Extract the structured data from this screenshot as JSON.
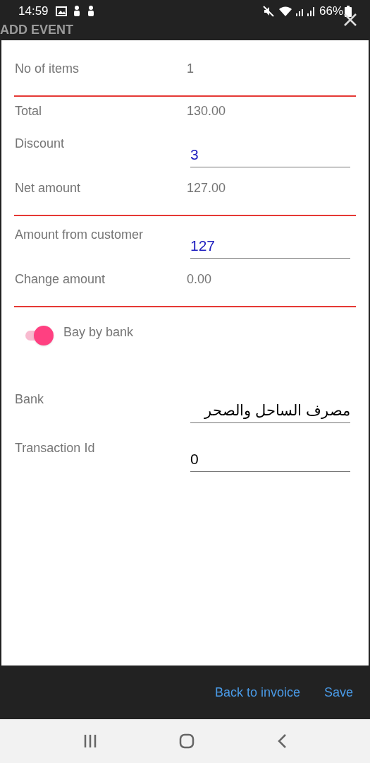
{
  "status_bar": {
    "time": "14:59",
    "battery": "66%"
  },
  "dialog": {
    "title": "ADD EVENT"
  },
  "rows": [
    {
      "kind": "text",
      "label": "No of items",
      "value": "1"
    },
    {
      "kind": "divider"
    },
    {
      "kind": "text",
      "label": "Total",
      "value": "130.00"
    },
    {
      "kind": "field",
      "label": "Discount",
      "value": "3",
      "highlighted": true
    },
    {
      "kind": "text",
      "label": "Net amount",
      "value": "127.00"
    },
    {
      "kind": "divider"
    },
    {
      "kind": "field",
      "label": "Amount from customer",
      "value": "127",
      "highlighted": true
    },
    {
      "kind": "text",
      "label": "Change amount",
      "value": "0.00"
    },
    {
      "kind": "divider"
    },
    {
      "kind": "toggle",
      "label": "Bay by bank",
      "on": true
    },
    {
      "kind": "field",
      "label": "Bank",
      "value": "مصرف الساحل والصحر",
      "highlighted": false
    },
    {
      "kind": "field",
      "label": "Transaction Id",
      "value": "0",
      "highlighted": false
    }
  ],
  "buttons": [
    "Back to invoice",
    "Save"
  ]
}
